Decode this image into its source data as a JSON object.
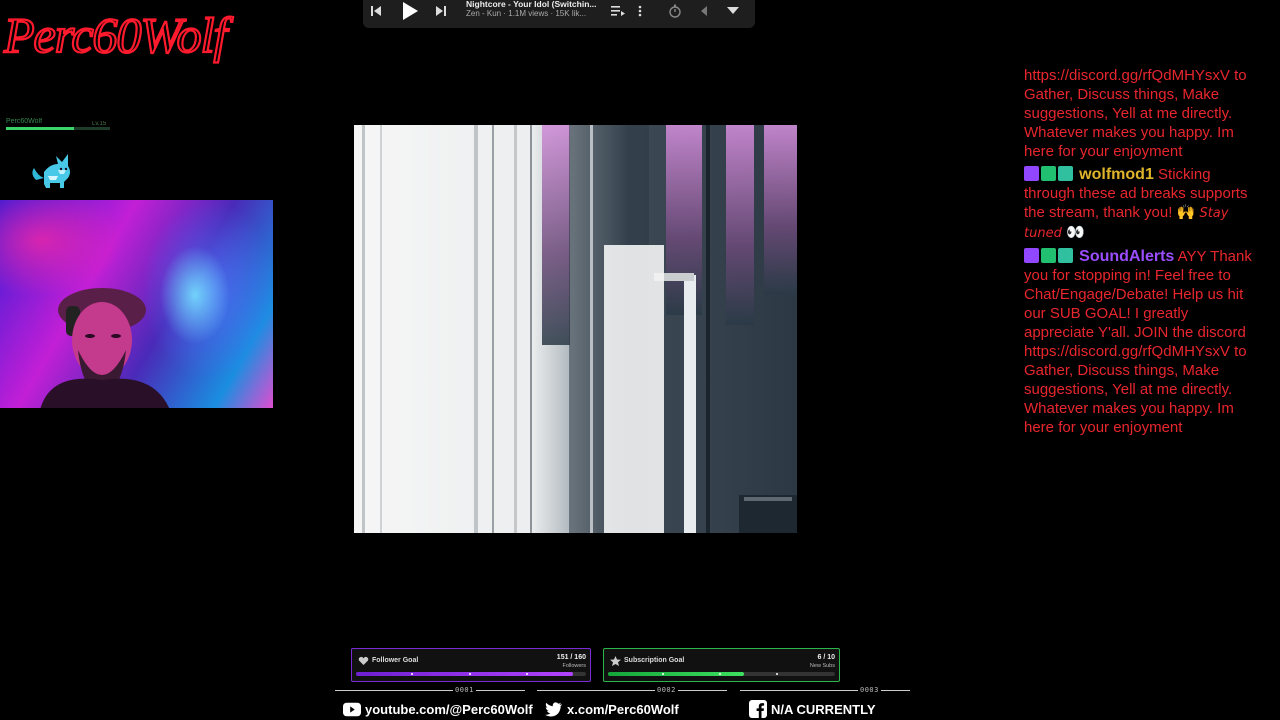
{
  "branding": {
    "logo_text": "Perc60Wolf",
    "mini_label": "Perc60Wolf",
    "mini_value": "Lv.15",
    "mini_progress": 0.65
  },
  "player": {
    "title": "Nightcore - Your Idol (Switchin...",
    "subtitle": "Zen - Kun · 1.1M views · 15K lik..."
  },
  "chat": {
    "messages": [
      {
        "text": "https://discord.gg/rfQdMHYsxV to Gather, Discuss things, Make suggestions, Yell at me directly. Whatever makes you happy. Im here for your enjoyment"
      },
      {
        "user": "wolfmod1",
        "user_color": "#e0b42a",
        "text": "Sticking through these ad breaks supports the stream, thank you! 🙌 ",
        "emote": "Stay tuned",
        "tail": "👀"
      },
      {
        "user": "SoundAlerts",
        "user_color": "#9b4dff",
        "text": "AYY Thank you for stopping in! Feel free to Chat/Engage/Debate! Help us hit our SUB GOAL! I greatly appreciate Y'all. JOIN the discord https://discord.gg/rfQdMHYsxV to Gather, Discuss things, Make suggestions, Yell at me directly. Whatever makes you happy. Im here for your enjoyment"
      }
    ]
  },
  "goals": {
    "follower": {
      "label": "Follower Goal",
      "count": "151 / 160",
      "unit": "Followers",
      "current": 151,
      "target": 160
    },
    "subscription": {
      "label": "Subscription Goal",
      "count": "6 / 10",
      "unit": "New Subs",
      "current": 6,
      "target": 10
    }
  },
  "socials": {
    "youtube": {
      "num": "0001",
      "label": "youtube.com/@Perc60Wolf"
    },
    "x": {
      "num": "0002",
      "label": "x.com/Perc60Wolf"
    },
    "facebook": {
      "num": "0003",
      "label": "N/A CURRENTLY"
    }
  },
  "colors": {
    "chat_text": "#e8262e",
    "follower_accent": "#7a2bd4",
    "sub_accent": "#2bb54a"
  }
}
